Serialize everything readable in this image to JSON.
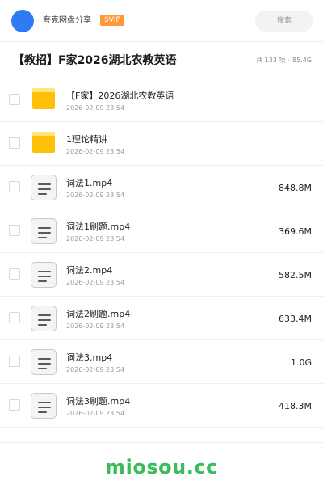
{
  "header": {
    "app_name": "夸克网盘分享",
    "badge": "SVIP",
    "search_placeholder": "搜索"
  },
  "folder": {
    "title": "【教招】F家2026湖北农教英语",
    "count_label": "共 133 项",
    "separator": "·",
    "total_size": "85.4G"
  },
  "items": [
    {
      "type": "folder",
      "icon": "folder-icon",
      "name": "【F家】2026湖北农教英语",
      "date": "2026-02-09 23:54",
      "size": ""
    },
    {
      "type": "folder",
      "icon": "folder-icon",
      "name": "1理论精讲",
      "date": "2026-02-09 23:54",
      "size": ""
    },
    {
      "type": "file",
      "icon": "document-icon",
      "name": "词法1.mp4",
      "date": "2026-02-09 23:54",
      "size": "848.8M"
    },
    {
      "type": "file",
      "icon": "document-icon",
      "name": "词法1刷题.mp4",
      "date": "2026-02-09 23:54",
      "size": "369.6M"
    },
    {
      "type": "file",
      "icon": "document-icon",
      "name": "词法2.mp4",
      "date": "2026-02-09 23:54",
      "size": "582.5M"
    },
    {
      "type": "file",
      "icon": "document-icon",
      "name": "词法2刷题.mp4",
      "date": "2026-02-09 23:54",
      "size": "633.4M"
    },
    {
      "type": "file",
      "icon": "document-icon",
      "name": "词法3.mp4",
      "date": "2026-02-09 23:54",
      "size": "1.0G"
    },
    {
      "type": "file",
      "icon": "document-icon",
      "name": "词法3刷题.mp4",
      "date": "2026-02-09 23:54",
      "size": "418.3M"
    }
  ],
  "watermark": "miosou.cc",
  "colors": {
    "accent_blue": "#2f7bf6",
    "svip_orange": "#ff9a3c",
    "folder_yellow": "#ffc107",
    "watermark_green": "#3dbb5a"
  }
}
